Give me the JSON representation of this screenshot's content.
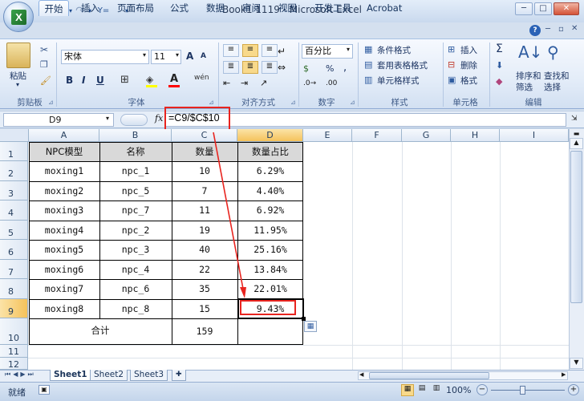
{
  "window": {
    "title": "Book1 1119 - Microsoft Excel"
  },
  "qat": {
    "undo": "↶",
    "redo": "↷"
  },
  "tabs": [
    "开始",
    "插入",
    "页面布局",
    "公式",
    "数据",
    "审阅",
    "视图",
    "开发工具",
    "Acrobat"
  ],
  "ribbon": {
    "clipboard": {
      "paste": "粘贴",
      "label": "剪贴板"
    },
    "font": {
      "name": "宋体",
      "size": "11",
      "bold": "B",
      "italic": "I",
      "underline": "U",
      "grow": "A",
      "shrink": "A",
      "label": "字体"
    },
    "alignment": {
      "label": "对齐方式"
    },
    "number": {
      "format": "百分比",
      "percent": "%",
      "comma": ",",
      "label": "数字"
    },
    "styles": {
      "conditional": "条件格式",
      "table": "套用表格格式",
      "cell": "单元格样式",
      "label": "样式"
    },
    "cells": {
      "insert": "插入",
      "delete": "删除",
      "format": "格式",
      "label": "单元格"
    },
    "editing": {
      "sigma": "Σ",
      "sort": "排序和\n筛选",
      "find": "查找和\n选择",
      "sort_l1": "排序和",
      "sort_l2": "筛选",
      "find_l1": "查找和",
      "find_l2": "选择",
      "label": "编辑"
    }
  },
  "formula_bar": {
    "name_box": "D9",
    "fx": "fx",
    "formula": "=C9/$C$10"
  },
  "columns": [
    "A",
    "B",
    "C",
    "D",
    "E",
    "F",
    "G",
    "H",
    "I"
  ],
  "rows": [
    "1",
    "2",
    "3",
    "4",
    "5",
    "6",
    "7",
    "8",
    "9",
    "10",
    "11",
    "12"
  ],
  "table": {
    "headers": [
      "NPC模型",
      "名称",
      "数量",
      "数量占比"
    ],
    "rows": [
      [
        "moxing1",
        "npc_1",
        "10",
        "6.29%"
      ],
      [
        "moxing2",
        "npc_5",
        "7",
        "4.40%"
      ],
      [
        "moxing3",
        "npc_7",
        "11",
        "6.92%"
      ],
      [
        "moxing4",
        "npc_2",
        "19",
        "11.95%"
      ],
      [
        "moxing5",
        "npc_3",
        "40",
        "25.16%"
      ],
      [
        "moxing6",
        "npc_4",
        "22",
        "13.84%"
      ],
      [
        "moxing7",
        "npc_6",
        "35",
        "22.01%"
      ],
      [
        "moxing8",
        "npc_8",
        "15",
        "9.43%"
      ]
    ],
    "total_label": "合计",
    "total_value": "159"
  },
  "sheets": [
    "Sheet1",
    "Sheet2",
    "Sheet3"
  ],
  "status": {
    "ready": "就绪",
    "zoom": "100%"
  },
  "colors": {
    "annotation": "#e8241f",
    "header_fill": "#d9d9d9",
    "active_col": "#f7d27f"
  }
}
